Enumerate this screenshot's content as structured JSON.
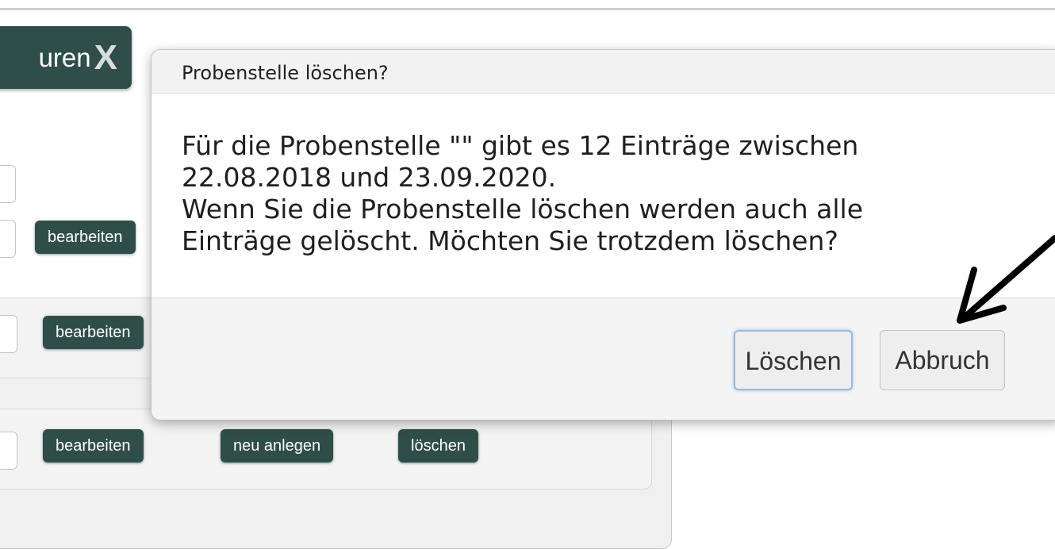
{
  "logo": {
    "text": "uren",
    "mark": "X"
  },
  "background_buttons": {
    "edit_1": "bearbeiten",
    "edit_2": "bearbeiten",
    "edit_3": "bearbeiten",
    "new": "neu anlegen",
    "delete": "löschen"
  },
  "dialog": {
    "title": "Probenstelle löschen?",
    "line1": "Für die Probenstelle \"\" gibt es 12 Einträge zwischen",
    "line2": "22.08.2018 und 23.09.2020.",
    "line3": "Wenn Sie die Probenstelle löschen werden auch alle",
    "line4": "Einträge gelöscht. Möchten Sie trotzdem löschen?",
    "confirm_label": "Löschen",
    "cancel_label": "Abbruch"
  },
  "colors": {
    "button_dark": "#2f4e4a",
    "focus_ring": "#9fbfe6"
  }
}
